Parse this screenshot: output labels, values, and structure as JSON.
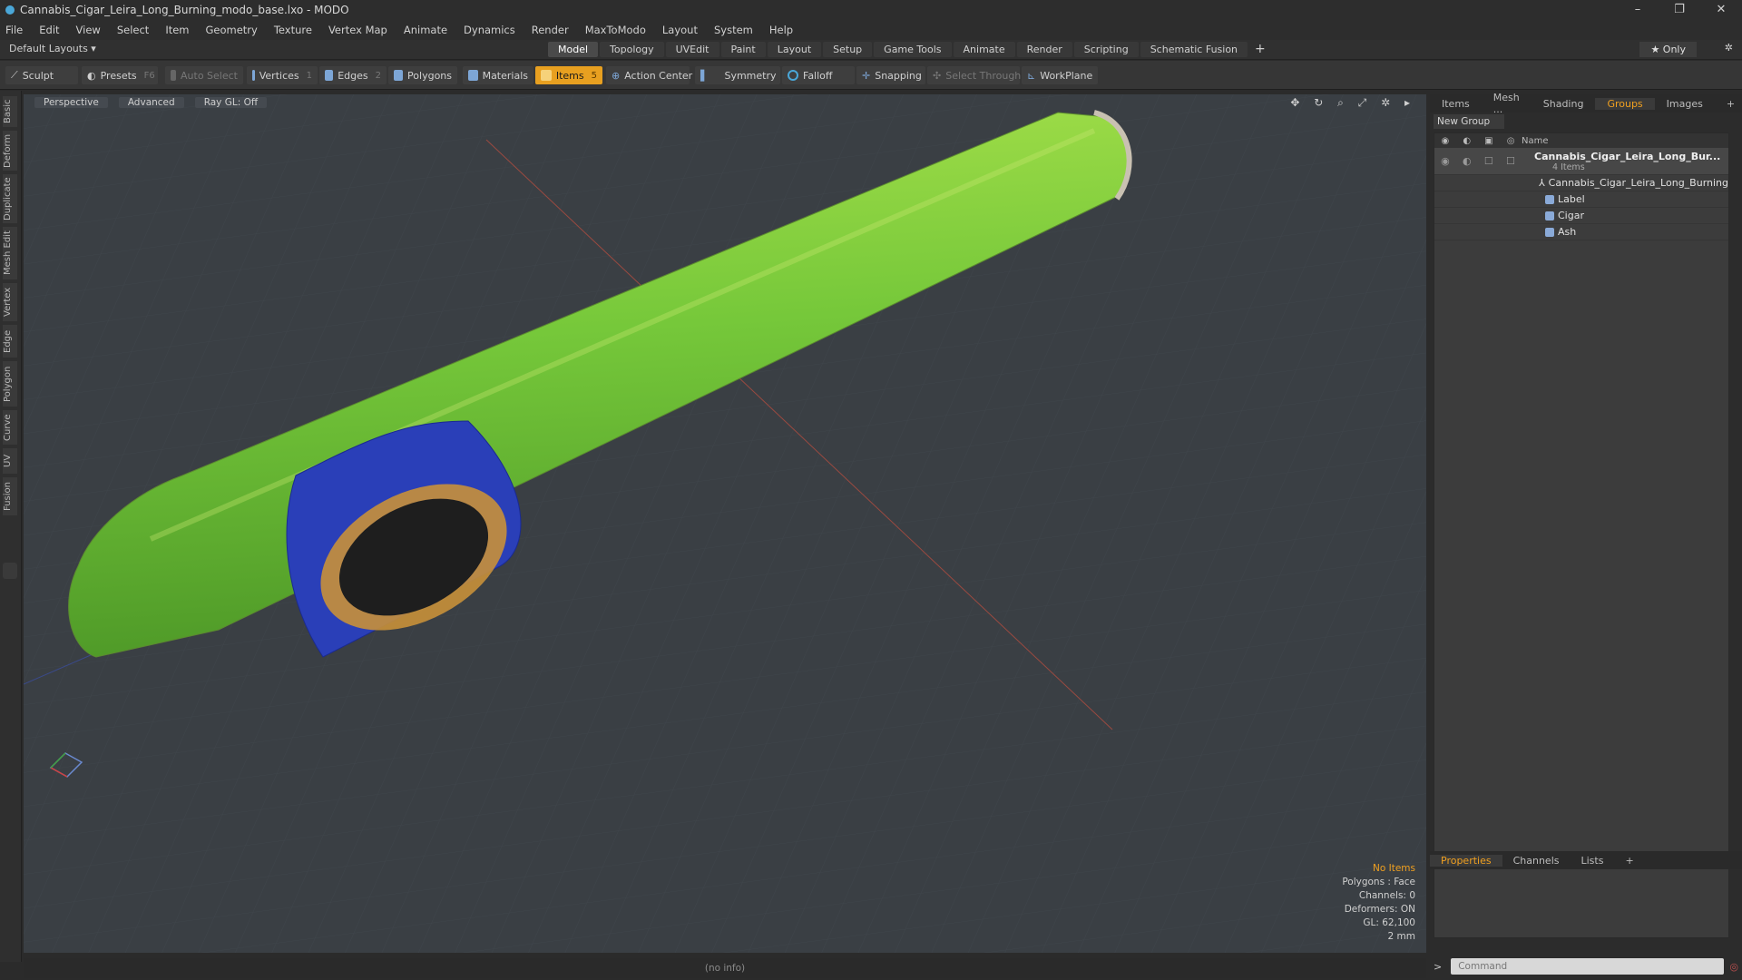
{
  "window": {
    "title": "Cannabis_Cigar_Leira_Long_Burning_modo_base.lxo - MODO",
    "minimize": "–",
    "restore": "❐",
    "close": "✕"
  },
  "menu": [
    "File",
    "Edit",
    "View",
    "Select",
    "Item",
    "Geometry",
    "Texture",
    "Vertex Map",
    "Animate",
    "Dynamics",
    "Render",
    "MaxToModo",
    "Layout",
    "System",
    "Help"
  ],
  "layouts": {
    "label": "Default Layouts ▾",
    "tabs": [
      "Model",
      "Topology",
      "UVEdit",
      "Paint",
      "Layout",
      "Setup",
      "Game Tools",
      "Animate",
      "Render",
      "Scripting",
      "Schematic Fusion"
    ],
    "add": "+",
    "only": "★  Only"
  },
  "toolbar": {
    "sculpt": "Sculpt",
    "presets": "Presets",
    "presets_key": "F6",
    "auto_select": "Auto Select",
    "vertices": "Vertices",
    "vertices_key": "1",
    "edges": "Edges",
    "edges_key": "2",
    "polygons": "Polygons",
    "materials": "Materials",
    "items": "Items",
    "items_key": "5",
    "action_center": "Action Center",
    "symmetry": "Symmetry",
    "falloff": "Falloff",
    "snapping": "Snapping",
    "select_through": "Select Through",
    "workplane": "WorkPlane"
  },
  "left_tabs": [
    "Basic",
    "Deform",
    "Duplicate",
    "Mesh Edit",
    "Vertex",
    "Edge",
    "Polygon",
    "Curve",
    "UV",
    "Fusion"
  ],
  "viewport": {
    "view": "Perspective",
    "shading": "Advanced",
    "raygl": "Ray GL: Off",
    "icons": "✥ ↻ ⌕ ⤢ ✲ ▸"
  },
  "info": {
    "selection": "No Items",
    "polygons": "Polygons : Face",
    "channels": "Channels: 0",
    "deformers": "Deformers: ON",
    "gl": "GL: 62,100",
    "scale": "2 mm"
  },
  "status": "(no info)",
  "right_panel": {
    "tabs": [
      "Items",
      "Mesh ...",
      "Shading",
      "Groups",
      "Images",
      "+"
    ],
    "new_group": "New Group",
    "name_header": "Name",
    "group": {
      "name": "Cannabis_Cigar_Leira_Long_Bur...",
      "count": "4 Items"
    },
    "items": [
      "Cannabis_Cigar_Leira_Long_Burning",
      "Label",
      "Cigar",
      "Ash"
    ]
  },
  "props": {
    "tabs": [
      "Properties",
      "Channels",
      "Lists",
      "+"
    ],
    "command_placeholder": "Command",
    "prompt": ">"
  },
  "colors": {
    "accent": "#f0a020",
    "cigar": "#7ec83a",
    "band_blue": "#2a3fb8",
    "band_gold": "#d8a040"
  }
}
